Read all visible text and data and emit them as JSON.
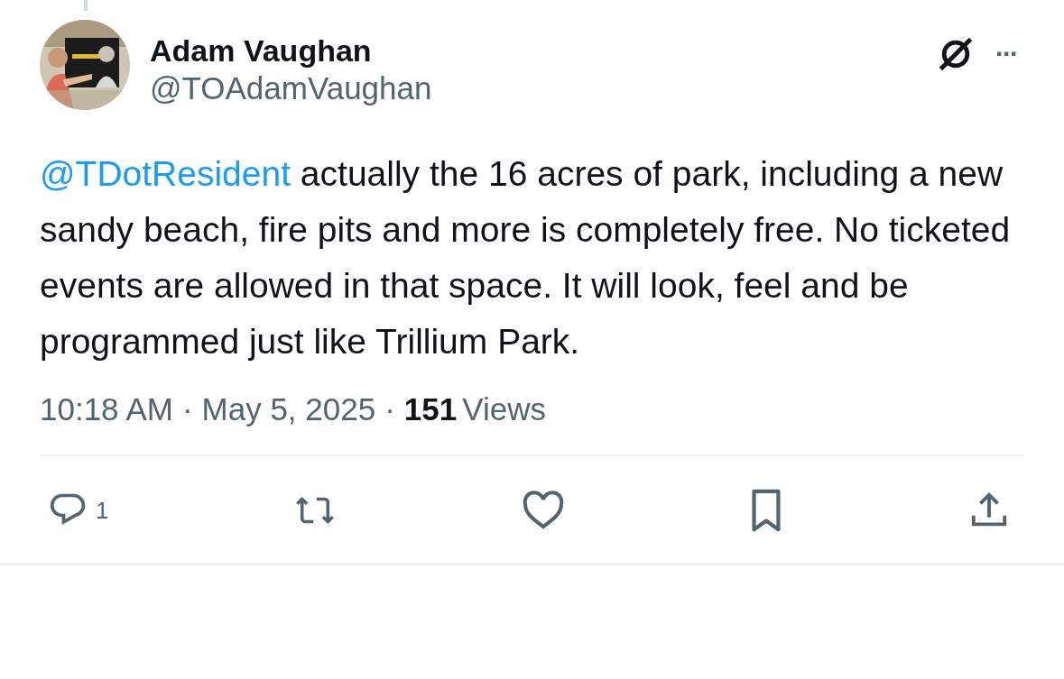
{
  "author": {
    "name": "Adam Vaughan",
    "handle": "@TOAdamVaughan"
  },
  "header_actions": {
    "more": "···"
  },
  "body": {
    "mention": "@TDotResident",
    "text": " actually the 16 acres of park, including a new sandy beach, fire pits and more is completely free. No ticketed events are allowed in that space. It will look, feel and be programmed just like Trillium Park."
  },
  "meta": [
    {
      "kind": "time",
      "text": "10:18 AM"
    },
    {
      "kind": "sep",
      "text": "·"
    },
    {
      "kind": "date",
      "text": "May 5, 2025"
    },
    {
      "kind": "sep",
      "text": "·"
    },
    {
      "kind": "count",
      "text": "151"
    },
    {
      "kind": "label",
      "text": "Views"
    }
  ],
  "actions": [
    {
      "kind": "reply",
      "count": "1"
    },
    {
      "kind": "repost"
    },
    {
      "kind": "like"
    },
    {
      "kind": "bookmark"
    },
    {
      "kind": "share"
    }
  ]
}
